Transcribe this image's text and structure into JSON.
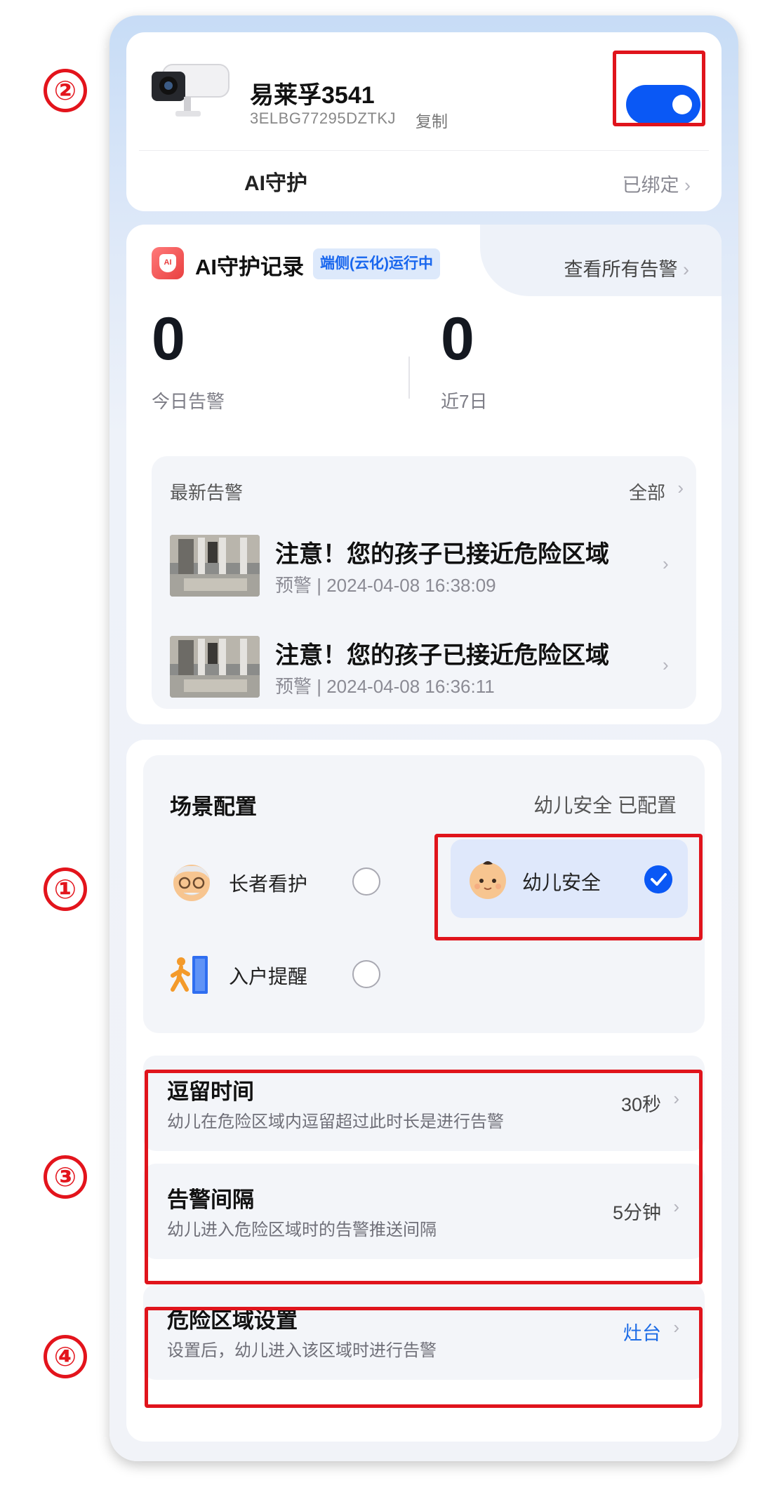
{
  "device": {
    "name": "易莱孚3541",
    "serial": "3ELBG77295DZTKJ",
    "copy_label": "复制",
    "toggle_on": true,
    "feature_label": "AI守护",
    "bind_status": "已绑定"
  },
  "record": {
    "badge_text": "AI",
    "title": "AI守护记录",
    "status_chip": "端侧(云化)运行中",
    "view_all": "查看所有告警",
    "today_count": "0",
    "today_label": "今日告警",
    "week_count": "0",
    "week_label": "近7日",
    "latest_title": "最新告警",
    "latest_all": "全部",
    "alerts": [
      {
        "title": "注意！您的孩子已接近危险区域",
        "meta": "预警 | 2024-04-08 16:38:09"
      },
      {
        "title": "注意！您的孩子已接近危险区域",
        "meta": "预警 | 2024-04-08 16:36:11"
      }
    ]
  },
  "scene": {
    "title": "场景配置",
    "status": "幼儿安全 已配置",
    "options": [
      {
        "label": "长者看护",
        "selected": false,
        "icon": "elder-face-icon"
      },
      {
        "label": "幼儿安全",
        "selected": true,
        "icon": "baby-face-icon"
      },
      {
        "label": "入户提醒",
        "selected": false,
        "icon": "door-entry-icon"
      }
    ]
  },
  "settings": {
    "stay_time": {
      "title": "逗留时间",
      "desc": "幼儿在危险区域内逗留超过此时长是进行告警",
      "value": "30秒"
    },
    "alert_interval": {
      "title": "告警间隔",
      "desc": "幼儿进入危险区域时的告警推送间隔",
      "value": "5分钟"
    },
    "danger_zone": {
      "title": "危险区域设置",
      "desc": "设置后，幼儿进入该区域时进行告警",
      "value": "灶台"
    }
  },
  "annotations": {
    "n1": "①",
    "n2": "②",
    "n3": "③",
    "n4": "④"
  },
  "colors": {
    "accent": "#0a58f5",
    "annotation_red": "#e0141c",
    "link_blue": "#1d6ce6"
  }
}
